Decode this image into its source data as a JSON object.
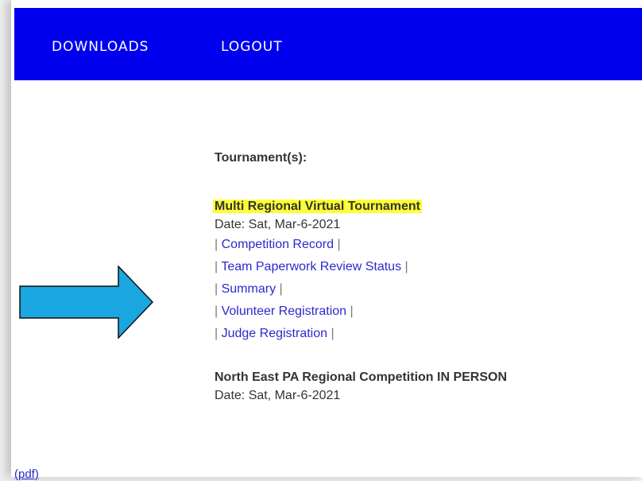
{
  "nav": {
    "downloads": "DOWNLOADS",
    "logout": "LOGOUT"
  },
  "tournaments": {
    "heading": "Tournament(s):",
    "first": {
      "name": "Multi Regional Virtual Tournament",
      "date": "Date: Sat, Mar-6-2021",
      "links": [
        "Competition Record",
        "Team Paperwork Review Status",
        "Summary",
        "Volunteer Registration",
        "Judge Registration"
      ]
    },
    "second": {
      "name": "North East PA Regional Competition IN PERSON",
      "date": "Date: Sat, Mar-6-2021"
    }
  },
  "pdf_link": "(pdf)",
  "colors": {
    "navbar": "#0000ee",
    "highlight": "#ffff33",
    "arrow_fill": "#1aa6e0",
    "link": "#2a2ad0"
  }
}
